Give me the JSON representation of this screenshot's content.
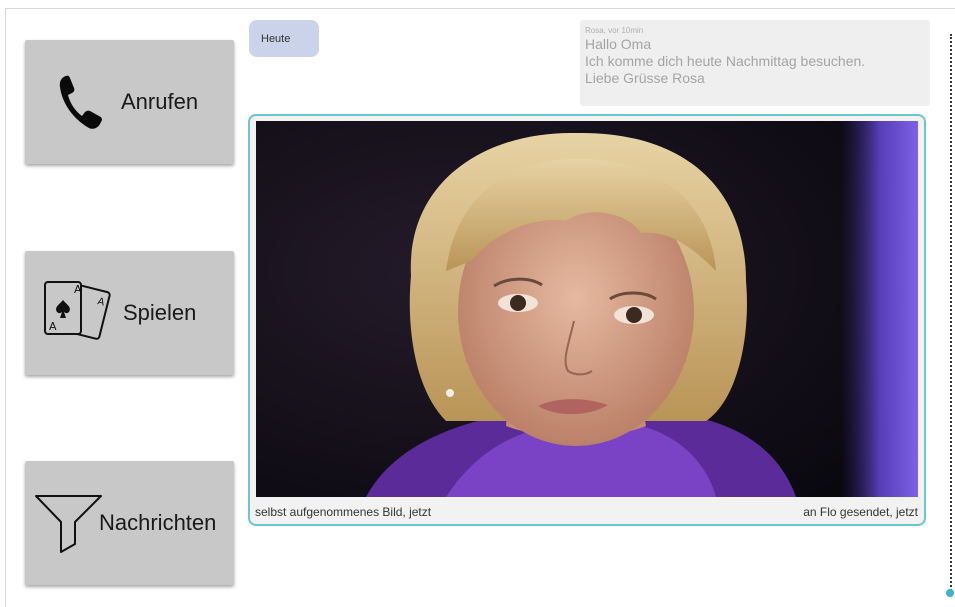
{
  "sidebar": {
    "call_label": "Anrufen",
    "play_label": "Spielen",
    "messages_label": "Nachrichten"
  },
  "chat": {
    "date_chip": "Heute",
    "message": {
      "meta": "Rosa, vor 10min",
      "lines": [
        "Hallo Oma",
        "Ich komme dich heute Nachmittag besuchen.",
        "Liebe Grüsse Rosa"
      ]
    },
    "photo_post": {
      "caption_left": "selbst aufgenommenes Bild, jetzt",
      "caption_right": "an Flo gesendet, jetzt"
    }
  },
  "colors": {
    "button_bg": "#c8c8c8",
    "date_chip_bg": "#cbd3ea",
    "photo_border": "#6cc6cf",
    "message_bg": "#efefef"
  },
  "icons": {
    "call": "phone-icon",
    "play": "playing-cards-icon",
    "messages": "filter-icon"
  }
}
